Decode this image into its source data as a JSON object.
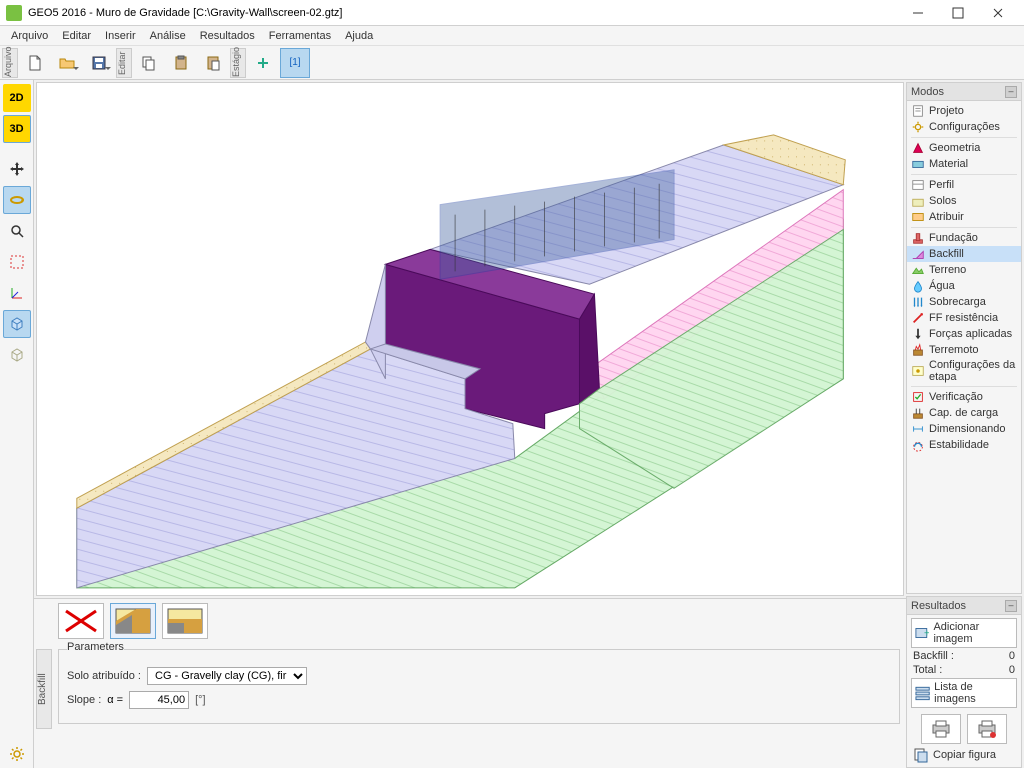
{
  "window": {
    "title": "GEO5 2016 - Muro de Gravidade [C:\\Gravity-Wall\\screen-02.gtz]"
  },
  "menu": {
    "items": [
      "Arquivo",
      "Editar",
      "Inserir",
      "Análise",
      "Resultados",
      "Ferramentas",
      "Ajuda"
    ]
  },
  "toolbar": {
    "groups": {
      "arquivo": "Arquivo",
      "editar": "Editar",
      "estagio": "Estágio"
    },
    "stage_label": "[1]"
  },
  "left_tools": {
    "btn2d": "2D",
    "btn3d": "3D"
  },
  "modos": {
    "title": "Modos",
    "items": [
      {
        "icon": "doc",
        "label": "Projeto"
      },
      {
        "icon": "gear",
        "label": "Configurações"
      },
      {
        "sep": true
      },
      {
        "icon": "geom",
        "label": "Geometria"
      },
      {
        "icon": "mat",
        "label": "Material"
      },
      {
        "sep": true
      },
      {
        "icon": "profile",
        "label": "Perfil"
      },
      {
        "icon": "soil",
        "label": "Solos"
      },
      {
        "icon": "assign",
        "label": "Atribuir"
      },
      {
        "sep": true
      },
      {
        "icon": "found",
        "label": "Fundação"
      },
      {
        "icon": "backfill",
        "label": "Backfill",
        "selected": true
      },
      {
        "icon": "terrain",
        "label": "Terreno"
      },
      {
        "icon": "water",
        "label": "Água"
      },
      {
        "icon": "surch",
        "label": "Sobrecarga"
      },
      {
        "icon": "ffres",
        "label": "FF resistência"
      },
      {
        "icon": "forces",
        "label": "Forças aplicadas"
      },
      {
        "icon": "quake",
        "label": "Terremoto"
      },
      {
        "icon": "stage",
        "label": "Configurações da etapa"
      },
      {
        "sep": true
      },
      {
        "icon": "verify",
        "label": "Verificação"
      },
      {
        "icon": "bear",
        "label": "Cap. de carga"
      },
      {
        "icon": "dim",
        "label": "Dimensionando"
      },
      {
        "icon": "stab",
        "label": "Estabilidade"
      }
    ]
  },
  "resultados": {
    "title": "Resultados",
    "add_image": "Adicionar imagem",
    "rows": [
      {
        "label": "Backfill :",
        "value": "0"
      },
      {
        "label": "Total :",
        "value": "0"
      }
    ],
    "image_list": "Lista de imagens",
    "copy_fig": "Copiar figura"
  },
  "backfill_panel": {
    "side_tab": "Backfill",
    "fieldset": "Parameters",
    "soil_label": "Solo atribuído :",
    "soil_value": "CG - Gravelly clay (CG), firm consistency",
    "slope_label": "Slope :",
    "slope_symbol": "α  =",
    "slope_value": "45,00",
    "slope_unit": "[°]"
  }
}
